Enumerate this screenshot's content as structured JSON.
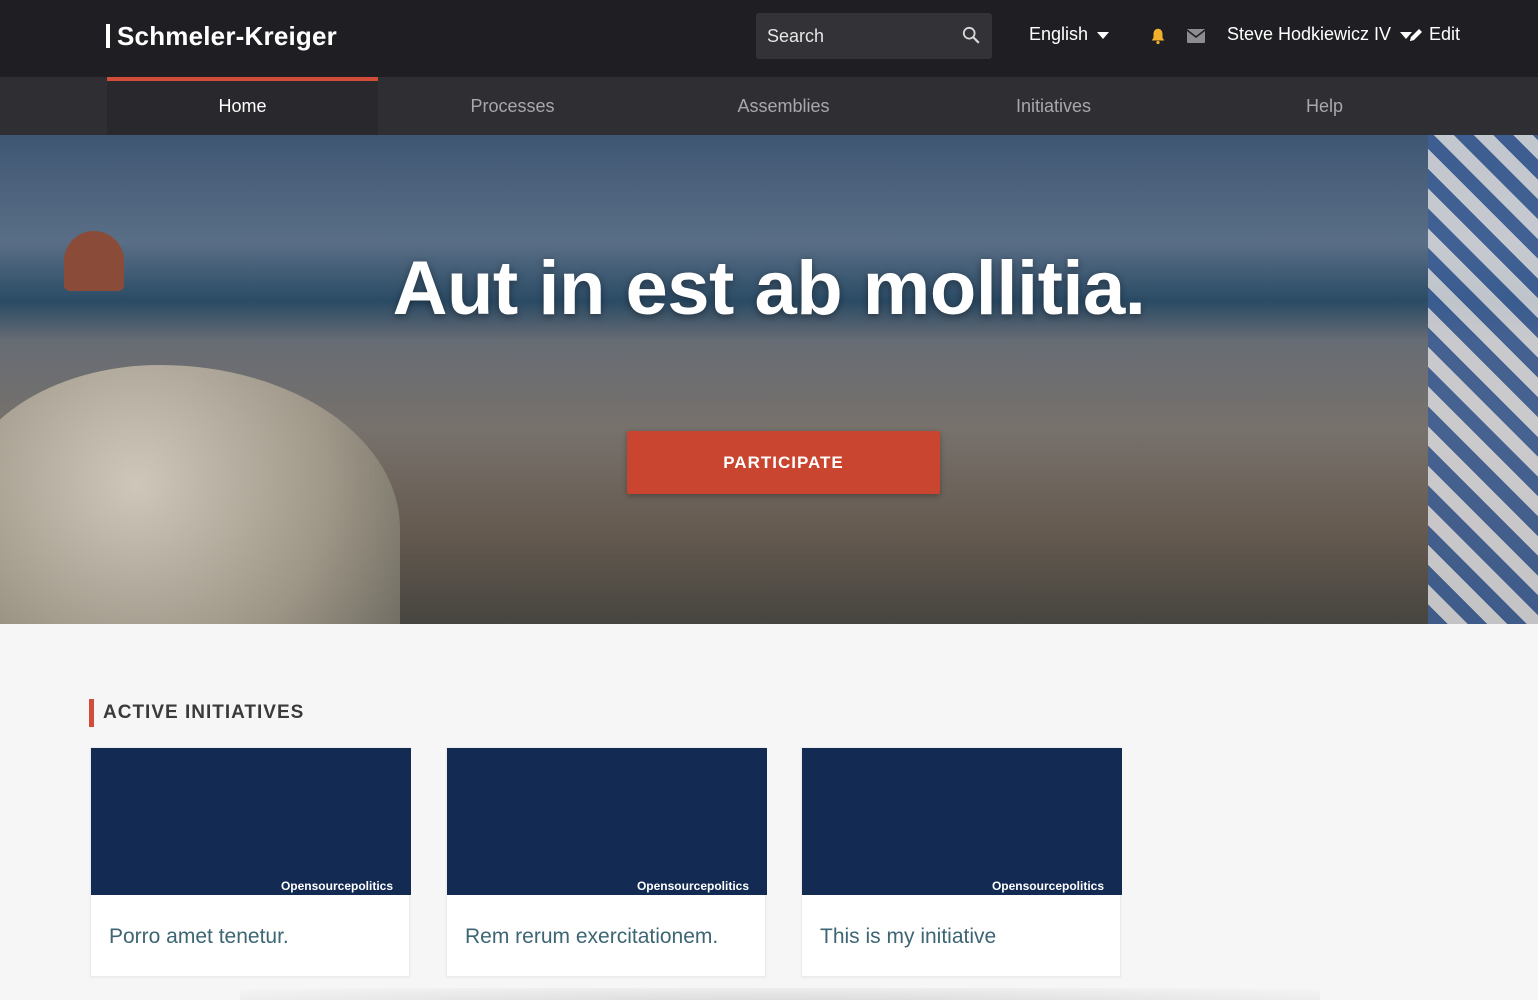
{
  "header": {
    "brand": "Schmeler-Kreiger",
    "search_placeholder": "Search",
    "language": "English",
    "user_name": "Steve Hodkiewicz IV",
    "edit_label": "Edit"
  },
  "nav": {
    "items": [
      {
        "label": "Home",
        "active": true
      },
      {
        "label": "Processes",
        "active": false
      },
      {
        "label": "Assemblies",
        "active": false
      },
      {
        "label": "Initiatives",
        "active": false
      },
      {
        "label": "Help",
        "active": false
      }
    ]
  },
  "hero": {
    "title": "Aut in est ab mollitia.",
    "cta_label": "PARTICIPATE"
  },
  "section": {
    "title": "ACTIVE INITIATIVES"
  },
  "cards": [
    {
      "logo_text": "Opensourcepolitics",
      "title": "Porro amet tenetur."
    },
    {
      "logo_text": "Opensourcepolitics",
      "title": "Rem rerum exercitationem."
    },
    {
      "logo_text": "Opensourcepolitics",
      "title": "This is my initiative"
    }
  ],
  "colors": {
    "accent": "#d14d39",
    "header_bg": "#1f1e22",
    "nav_bg": "#2f2e33",
    "card_image_bg": "#132b52",
    "card_title": "#3d6573",
    "bell": "#f2b12c"
  },
  "icons": {
    "search": "search-icon",
    "bell": "bell-icon",
    "mail": "mail-icon",
    "edit": "pencil-icon",
    "dropdown": "caret-down-icon"
  }
}
